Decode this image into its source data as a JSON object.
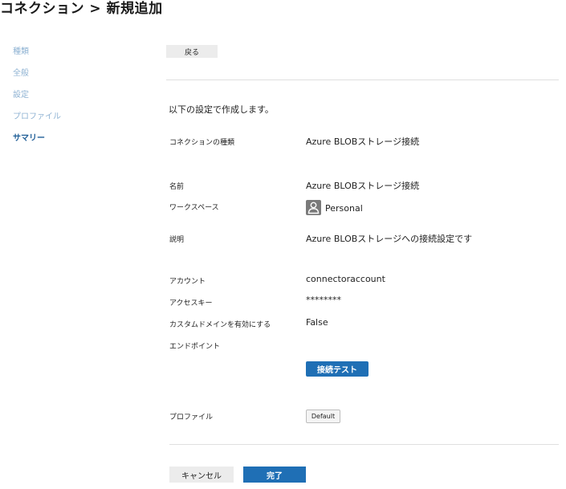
{
  "header": {
    "title": "コネクション > 新規追加"
  },
  "sidebar": {
    "items": [
      {
        "label": "種類"
      },
      {
        "label": "全般"
      },
      {
        "label": "設定"
      },
      {
        "label": "プロファイル"
      },
      {
        "label": "サマリー",
        "active": true
      }
    ]
  },
  "toolbar": {
    "back_label": "戻る"
  },
  "summary": {
    "intro": "以下の設定で作成します。",
    "connection_type": {
      "label": "コネクションの種類",
      "value": "Azure BLOBストレージ接続"
    },
    "name": {
      "label": "名前",
      "value": "Azure BLOBストレージ接続"
    },
    "workspace": {
      "label": "ワークスペース",
      "value": "Personal",
      "icon": "user-avatar-icon"
    },
    "description": {
      "label": "説明",
      "value": "Azure BLOBストレージへの接続設定です"
    },
    "account": {
      "label": "アカウント",
      "value": "connectoraccount"
    },
    "access_key": {
      "label": "アクセスキー",
      "value": "********"
    },
    "custom_domain": {
      "label": "カスタムドメインを有効にする",
      "value": "False"
    },
    "endpoint": {
      "label": "エンドポイント",
      "value": ""
    },
    "test_button": "接続テスト",
    "profile": {
      "label": "プロファイル",
      "button": "Default"
    }
  },
  "footer": {
    "cancel_label": "キャンセル",
    "finish_label": "完了"
  },
  "colors": {
    "accent": "#1f6fb5",
    "sidebar_active": "#1f5e97",
    "sidebar_inactive": "#8fb3d3",
    "avatar": "#7a7a7a"
  }
}
